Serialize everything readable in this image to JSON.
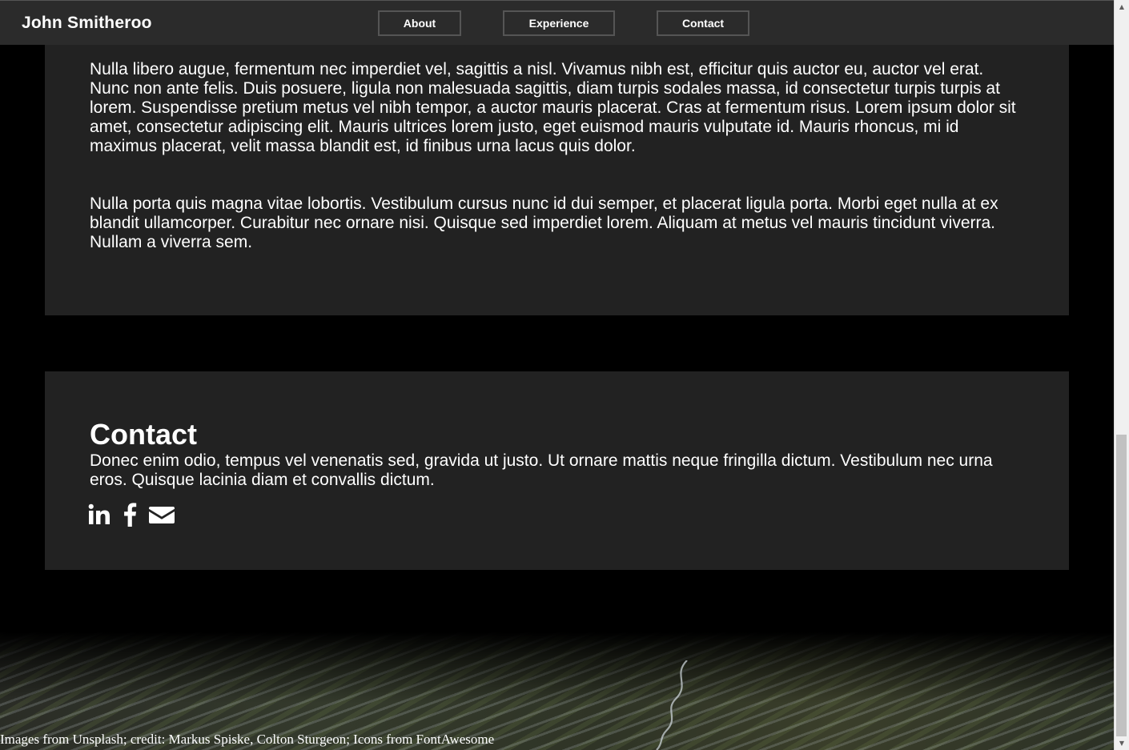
{
  "navbar": {
    "brand": "John Smitheroo",
    "links": [
      "About",
      "Experience",
      "Contact"
    ]
  },
  "experience": {
    "paragraphs": [
      "Nulla libero augue, fermentum nec imperdiet vel, sagittis a nisl. Vivamus nibh est, efficitur quis auctor eu, auctor vel erat. Nunc non ante felis. Duis posuere, ligula non malesuada sagittis, diam turpis sodales massa, id consectetur turpis turpis at lorem. Suspendisse pretium metus vel nibh tempor, a auctor mauris placerat. Cras at fermentum risus. Lorem ipsum dolor sit amet, consectetur adipiscing elit. Mauris ultrices lorem justo, eget euismod mauris vulputate id. Mauris rhoncus, mi id maximus placerat, velit massa blandit est, id finibus urna lacus quis dolor.",
      "Nulla porta quis magna vitae lobortis. Vestibulum cursus nunc id dui semper, et placerat ligula porta. Morbi eget nulla at ex blandit ullamcorper. Curabitur nec ornare nisi. Quisque sed imperdiet lorem. Aliquam at metus vel mauris tincidunt viverra. Nullam a viverra sem."
    ]
  },
  "contact": {
    "title": "Contact",
    "text": "Donec enim odio, tempus vel venenatis sed, gravida ut justo. Ut ornare mattis neque fringilla dictum. Vestibulum nec urna eros. Quisque lacinia diam et convallis dictum.",
    "icons": [
      "linkedin-icon",
      "facebook-icon",
      "envelope-icon"
    ]
  },
  "footer": {
    "credits": "Images from Unsplash; credit: Markus Spiske, Colton Sturgeon; Icons from FontAwesome"
  },
  "scrollbar": {
    "up_arrow": "▲",
    "down_arrow": "▼"
  }
}
